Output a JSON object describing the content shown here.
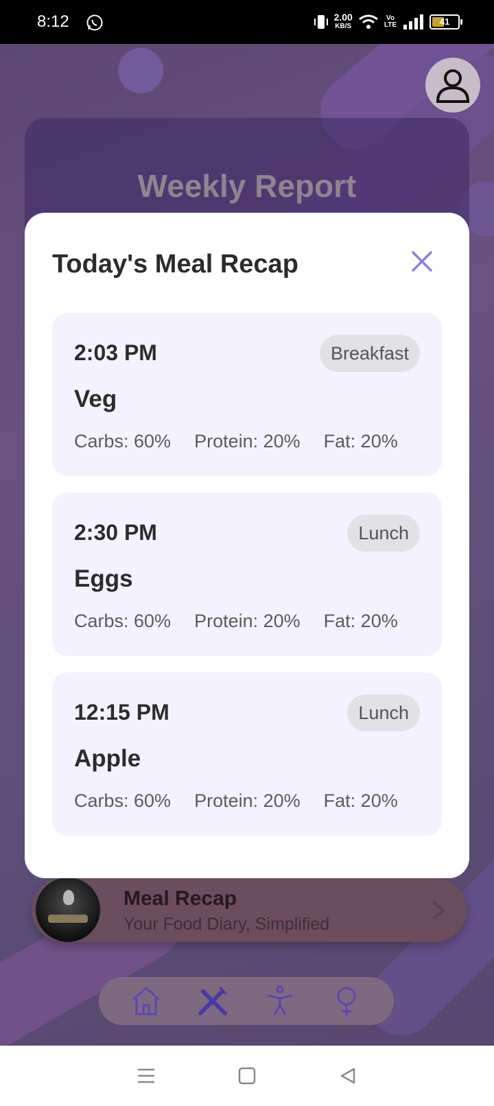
{
  "status_bar": {
    "time": "8:12",
    "net_speed": "2.00",
    "net_unit": "KB/S",
    "volte": "Vo\nLTE",
    "battery": "41"
  },
  "background": {
    "report_title": "Weekly Report",
    "meal_recap_title": "Meal Recap",
    "meal_recap_subtitle": "Your Food Diary, Simplified"
  },
  "modal": {
    "title": "Today's Meal Recap",
    "meals": [
      {
        "time": "2:03 PM",
        "tag": "Breakfast",
        "food": "Veg",
        "carbs": "Carbs: 60%",
        "protein": "Protein: 20%",
        "fat": "Fat: 20%"
      },
      {
        "time": "2:30 PM",
        "tag": "Lunch",
        "food": "Eggs",
        "carbs": "Carbs: 60%",
        "protein": "Protein: 20%",
        "fat": "Fat: 20%"
      },
      {
        "time": "12:15 PM",
        "tag": "Lunch",
        "food": "Apple",
        "carbs": "Carbs: 60%",
        "protein": "Protein: 20%",
        "fat": "Fat: 20%"
      }
    ]
  },
  "bottom_nav": [
    "home-icon",
    "utensils-icon",
    "fitness-icon",
    "female-icon"
  ],
  "colors": {
    "accent": "#8b7fd6",
    "card_bg": "#f4f2ff",
    "tag_bg": "#e3e1e6"
  }
}
